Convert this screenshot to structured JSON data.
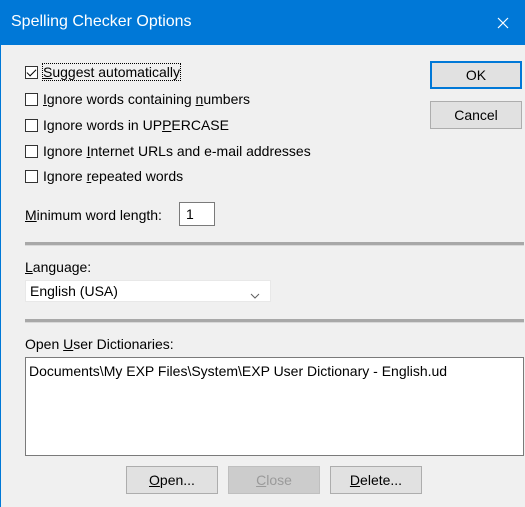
{
  "window": {
    "title": "Spelling Checker Options"
  },
  "options": [
    {
      "label_html": "<u>S</u>uggest automatically",
      "checked": true
    },
    {
      "label_html": "<u>I</u>gnore words containing <u>n</u>umbers",
      "checked": false
    },
    {
      "label_html": "Ignore words in UP<u>P</u>ERCASE",
      "checked": false
    },
    {
      "label_html": "Ignore <u>I</u>nternet URLs and e-mail addresses",
      "checked": false
    },
    {
      "label_html": "Ignore <u>r</u>epeated words",
      "checked": false
    }
  ],
  "buttons": {
    "ok": "OK",
    "cancel": "Cancel",
    "open": "Open...",
    "close": "Close",
    "delete": "Delete..."
  },
  "min_word_length": {
    "label": "Minimum word length:",
    "value": "1"
  },
  "language": {
    "label": "Language:",
    "selected": "English (USA)"
  },
  "dictionaries": {
    "label": "Open User Dictionaries:",
    "items": [
      "Documents\\My EXP Files\\System\\EXP User Dictionary - English.ud"
    ]
  }
}
